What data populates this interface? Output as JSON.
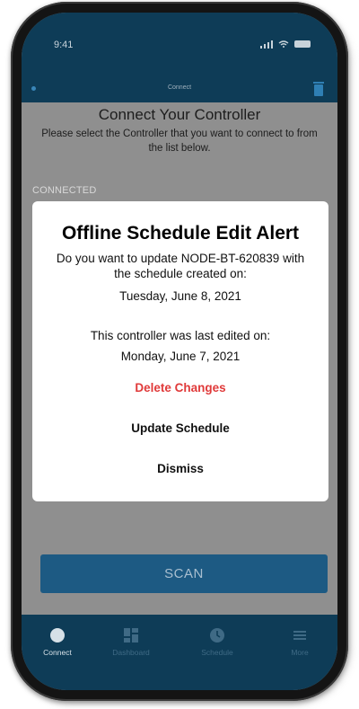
{
  "status": {
    "time": "9:41"
  },
  "nav": {
    "title": "Connect"
  },
  "connect": {
    "title": "Connect Your Controller",
    "subtitle": "Please select the Controller that you want to connect to from the list below.",
    "section": "CONNECTED"
  },
  "alert": {
    "title": "Offline Schedule Edit Alert",
    "message1": "Do you want to update NODE-BT-620839 with the schedule created on:",
    "date1": "Tuesday, June 8, 2021",
    "message2": "This controller was last edited on:",
    "date2": "Monday, June 7, 2021",
    "delete_label": "Delete Changes",
    "update_label": "Update Schedule",
    "dismiss_label": "Dismiss"
  },
  "scan": {
    "label": "SCAN"
  },
  "tabs": [
    {
      "label": "Connect",
      "icon": "circle-icon"
    },
    {
      "label": "Dashboard",
      "icon": "dashboard-icon"
    },
    {
      "label": "Schedule",
      "icon": "clock-icon"
    },
    {
      "label": "More",
      "icon": "menu-icon"
    }
  ],
  "colors": {
    "brand": "#0e3c57",
    "scan": "#1d5a83",
    "destructive": "#e03a3a"
  }
}
